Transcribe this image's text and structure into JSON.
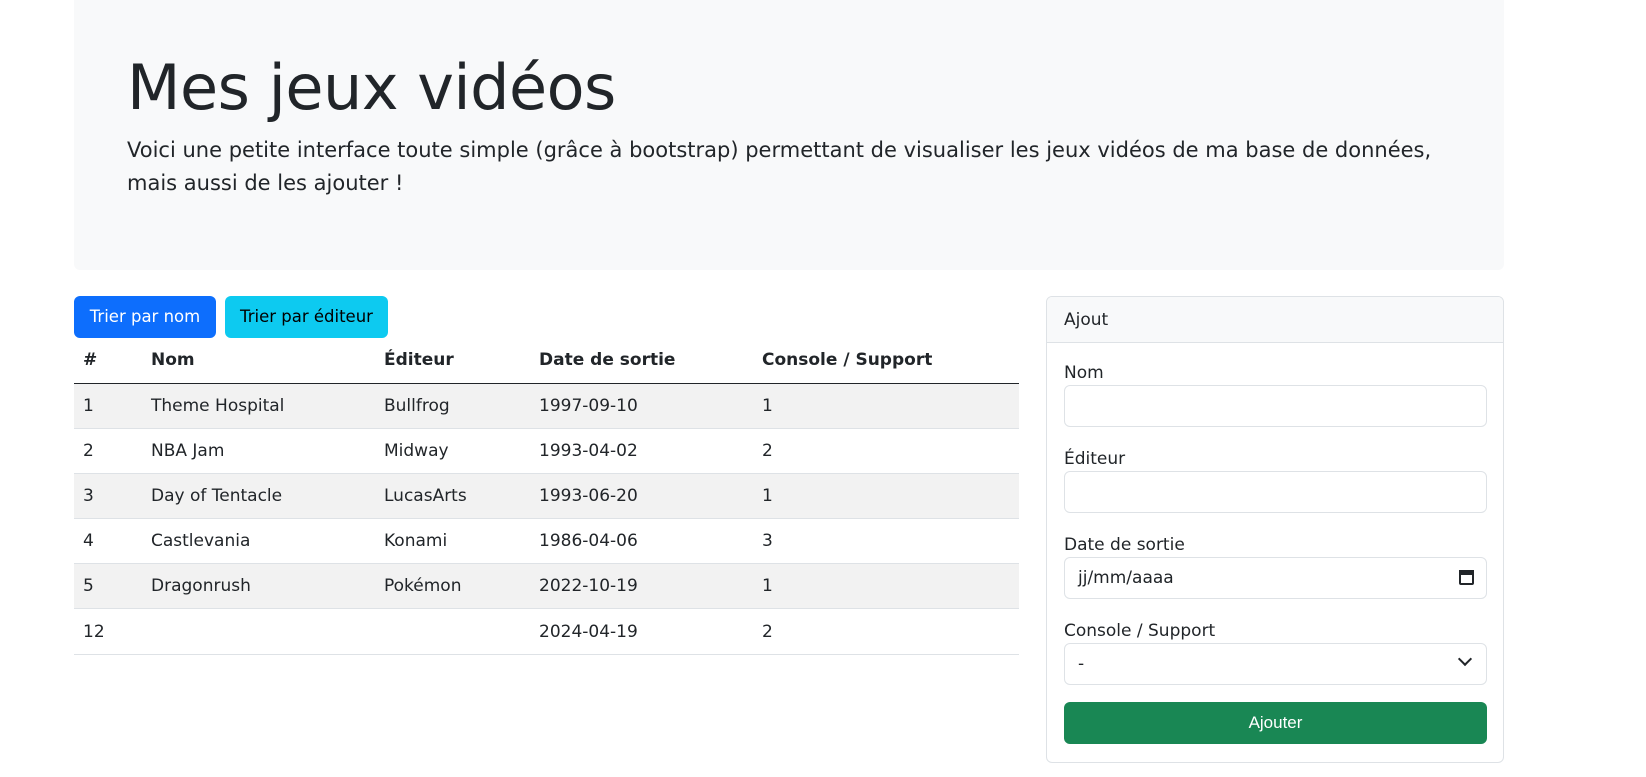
{
  "header": {
    "title": "Mes jeux vidéos",
    "lead": "Voici une petite interface toute simple (grâce à bootstrap) permettant de visualiser les jeux vidéos de ma base de données, mais aussi de les ajouter !"
  },
  "toolbar": {
    "sort_name_label": "Trier par nom",
    "sort_editor_label": "Trier par éditeur"
  },
  "table": {
    "columns": [
      "#",
      "Nom",
      "Éditeur",
      "Date de sortie",
      "Console / Support"
    ],
    "rows": [
      {
        "id": "1",
        "nom": "Theme Hospital",
        "editeur": "Bullfrog",
        "date": "1997-09-10",
        "console": "1"
      },
      {
        "id": "2",
        "nom": "NBA Jam",
        "editeur": "Midway",
        "date": "1993-04-02",
        "console": "2"
      },
      {
        "id": "3",
        "nom": "Day of Tentacle",
        "editeur": "LucasArts",
        "date": "1993-06-20",
        "console": "1"
      },
      {
        "id": "4",
        "nom": "Castlevania",
        "editeur": "Konami",
        "date": "1986-04-06",
        "console": "3"
      },
      {
        "id": "5",
        "nom": "Dragonrush",
        "editeur": "Pokémon",
        "date": "2022-10-19",
        "console": "1"
      },
      {
        "id": "12",
        "nom": "",
        "editeur": "",
        "date": "2024-04-19",
        "console": "2"
      }
    ]
  },
  "form": {
    "title": "Ajout",
    "nom_label": "Nom",
    "nom_value": "",
    "editeur_label": "Éditeur",
    "editeur_value": "",
    "date_label": "Date de sortie",
    "date_placeholder": "jj/mm/aaaa",
    "console_label": "Console / Support",
    "console_selected": "-",
    "submit_label": "Ajouter"
  },
  "colors": {
    "primary": "#0d6efd",
    "info": "#0dcaf0",
    "success": "#198754",
    "hero_bg": "#f8f9fa"
  },
  "icons": {
    "date": "calendar-icon",
    "select": "chevron-down-icon"
  }
}
